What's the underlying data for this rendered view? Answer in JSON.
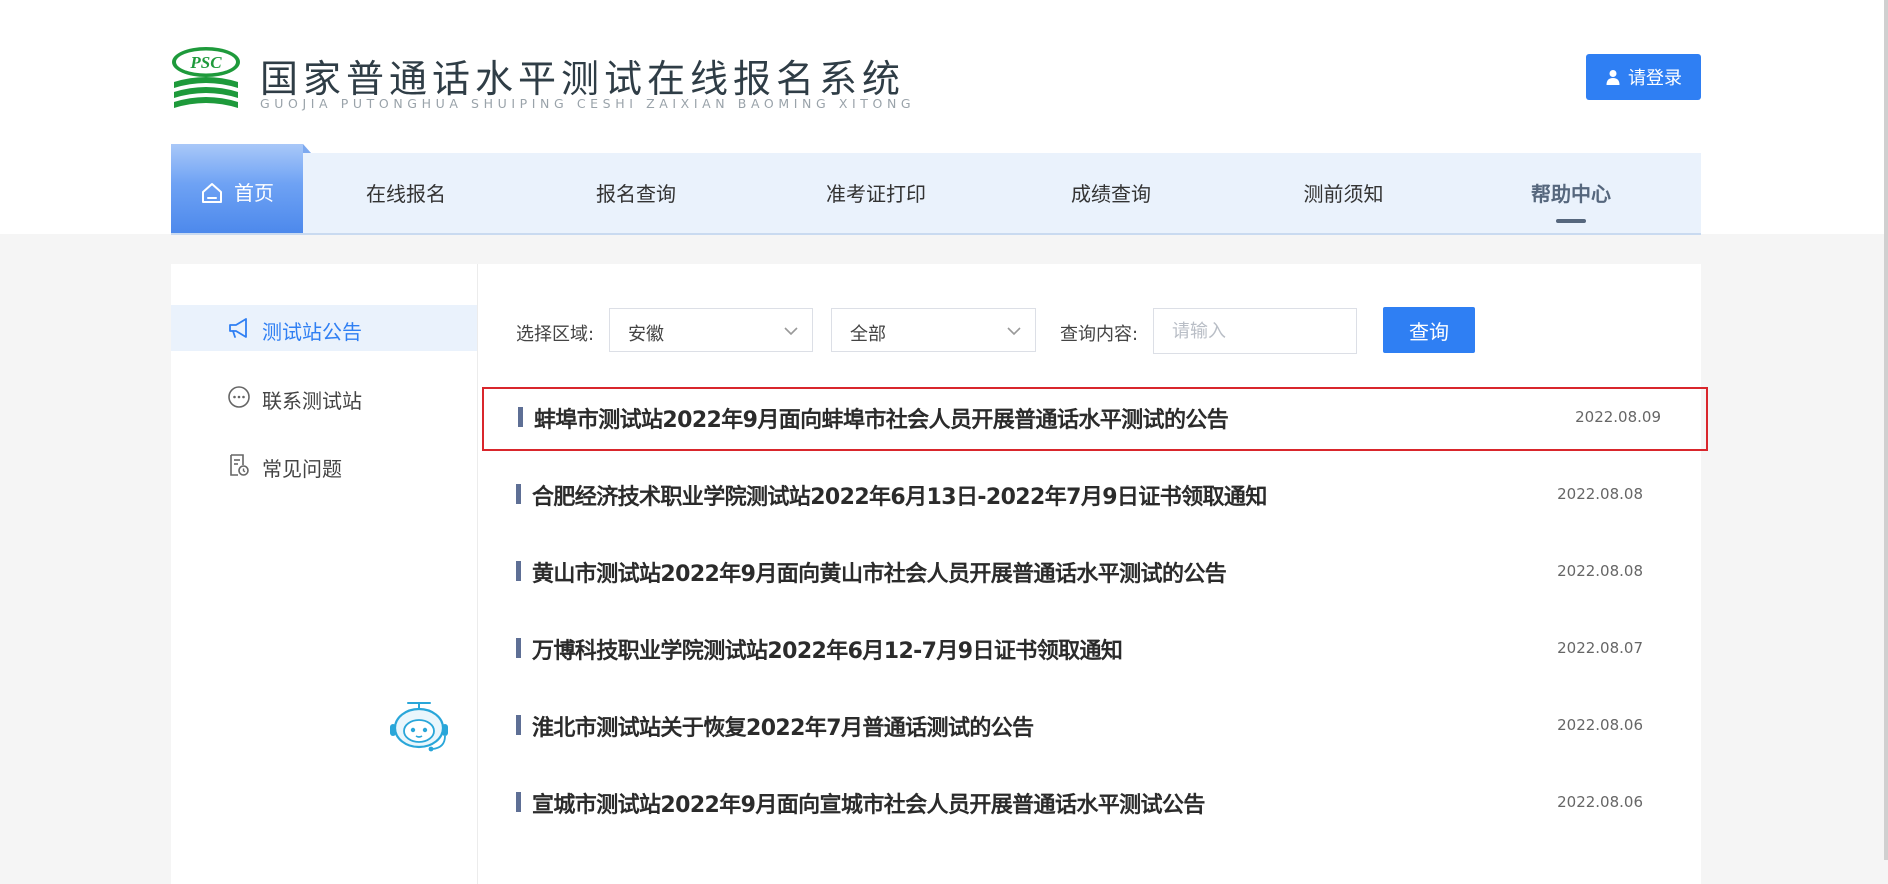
{
  "header": {
    "logo_badge": "PSC",
    "title": "国家普通话水平测试在线报名系统",
    "subtitle": "GUOJIA PUTONGHUA SHUIPING CESHI ZAIXIAN BAOMING XITONG",
    "login_label": "请登录"
  },
  "nav": {
    "items": [
      {
        "label": "首页",
        "icon": "home-icon",
        "active": true
      },
      {
        "label": "在线报名"
      },
      {
        "label": "报名查询"
      },
      {
        "label": "准考证打印"
      },
      {
        "label": "成绩查询"
      },
      {
        "label": "测前须知"
      },
      {
        "label": "帮助中心",
        "current": true
      }
    ]
  },
  "sidebar": {
    "items": [
      {
        "label": "测试站公告",
        "icon": "megaphone-icon",
        "active": true
      },
      {
        "label": "联系测试站",
        "icon": "chat-bubble-icon"
      },
      {
        "label": "常见问题",
        "icon": "document-clock-icon"
      }
    ]
  },
  "filter": {
    "region_label": "选择区域:",
    "province": "安徽",
    "city": "全部",
    "query_label": "查询内容:",
    "query_placeholder": "请输入",
    "query_button": "查询"
  },
  "news": [
    {
      "title": "蚌埠市测试站2022年9月面向蚌埠市社会人员开展普通话水平测试的公告",
      "date": "2022.08.09",
      "highlighted": true
    },
    {
      "title": "合肥经济技术职业学院测试站2022年6月13日-2022年7月9日证书领取通知",
      "date": "2022.08.08"
    },
    {
      "title": "黄山市测试站2022年9月面向黄山市社会人员开展普通话水平测试的公告",
      "date": "2022.08.08"
    },
    {
      "title": "万博科技职业学院测试站2022年6月12-7月9日证书领取通知",
      "date": "2022.08.07"
    },
    {
      "title": "淮北市测试站关于恢复2022年7月普通话测试的公告",
      "date": "2022.08.06"
    },
    {
      "title": "宣城市测试站2022年9月面向宣城市社会人员开展普通话水平测试公告",
      "date": "2022.08.06"
    }
  ],
  "colors": {
    "accent": "#2f7ff3",
    "highlight_border": "#d9262c",
    "logo_green": "#1e9a3b"
  }
}
